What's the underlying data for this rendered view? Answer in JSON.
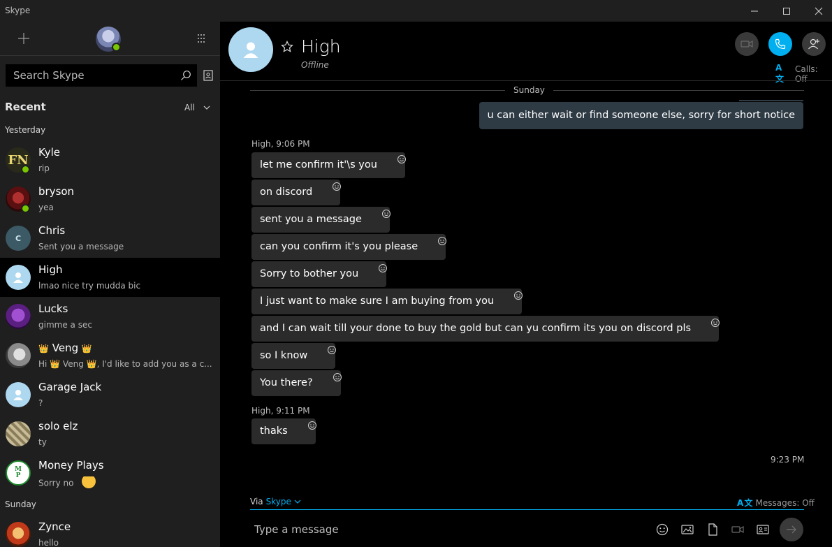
{
  "app": {
    "title": "Skype"
  },
  "window": {
    "minimize_icon": "minimize-icon",
    "maximize_icon": "maximize-icon",
    "close_icon": "close-icon"
  },
  "sidebar": {
    "search_placeholder": "Search Skype",
    "recent_label": "Recent",
    "filter_label": "All",
    "sections": [
      {
        "label": "Yesterday",
        "chats": [
          {
            "name": "Kyle",
            "preview": "rip",
            "online": true
          },
          {
            "name": "bryson",
            "preview": "yea",
            "online": true
          },
          {
            "name": "Chris",
            "preview": "Sent you a message",
            "initial": "C"
          },
          {
            "name": "High",
            "preview": "lmao nice try mudda bic",
            "active": true
          },
          {
            "name": "Lucks",
            "preview": "gimme a sec"
          },
          {
            "name": "Veng",
            "preview": "Hi 👑 Veng 👑, I'd like to add you as a c..."
          },
          {
            "name": "Garage Jack",
            "preview": "?"
          },
          {
            "name": "solo elz",
            "preview": "ty"
          },
          {
            "name": "Money Plays",
            "preview": "Sorry no"
          }
        ]
      },
      {
        "label": "Sunday",
        "chats": [
          {
            "name": "Zynce",
            "preview": "hello"
          }
        ]
      }
    ]
  },
  "conversation": {
    "contact_name": "High",
    "contact_status": "Offline",
    "calls_translate": "Calls: Off",
    "day_label": "Sunday",
    "sent_message": "u can either wait or find someone else, sorry for short notice",
    "groups": [
      {
        "meta": "High, 9:06 PM",
        "messages": [
          "let me confirm it'\\s you",
          "on discord",
          "sent you a message",
          "can you confirm it's you please",
          "Sorry to bother you",
          "I just want to make sure I am buying from you",
          "and I can wait till your done to buy the gold but can yu confirm its you on discord pls",
          "so I know",
          "You there?"
        ]
      },
      {
        "meta": "High, 9:11 PM",
        "messages": [
          "thaks"
        ]
      }
    ],
    "last_time": "9:23 PM",
    "via_label": "Via",
    "via_link": "Skype",
    "messages_translate": "Messages: Off",
    "compose_placeholder": "Type a message"
  },
  "colors": {
    "accent": "#00aff0",
    "presence": "#79c700",
    "sent_bubble": "#2e3a44",
    "received_bubble": "#2b2b2b"
  }
}
